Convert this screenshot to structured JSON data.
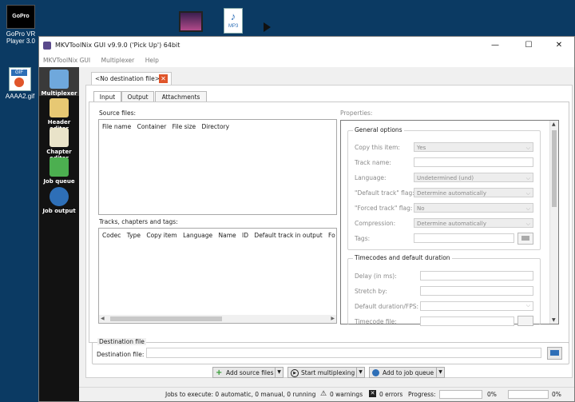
{
  "desktop": {
    "icons": [
      {
        "label": "GoPro VR Player 3.0"
      },
      {
        "label": "AAAA2.gif"
      },
      {
        "label": "MP3"
      }
    ]
  },
  "window": {
    "title": "MKVToolNix GUI v9.9.0 ('Pick Up') 64bit",
    "controls": {
      "minimize": "—",
      "maximize": "☐",
      "close": "✕"
    }
  },
  "menu": [
    "MKVToolNix GUI",
    "Multiplexer",
    "Help"
  ],
  "sidebar": [
    {
      "label": "Multiplexer",
      "icon": "multiplexer-icon"
    },
    {
      "label": "Header editor",
      "icon": "header-editor-icon"
    },
    {
      "label": "Chapter editor",
      "icon": "chapter-editor-icon"
    },
    {
      "label": "Job queue",
      "icon": "job-queue-icon"
    },
    {
      "label": "Job output",
      "icon": "job-output-icon"
    }
  ],
  "doc_tab": {
    "label": "<No destination file>",
    "close": "✕"
  },
  "tabs": [
    "Input",
    "Output",
    "Attachments"
  ],
  "source_files": {
    "label": "Source files:",
    "columns": [
      "File name",
      "Container",
      "File size",
      "Directory"
    ]
  },
  "tracks": {
    "label": "Tracks, chapters and tags:",
    "columns": [
      "Codec",
      "Type",
      "Copy item",
      "Language",
      "Name",
      "ID",
      "Default track in output",
      "Fo"
    ]
  },
  "properties": {
    "label": "Properties:",
    "general": {
      "title": "General options",
      "rows": [
        {
          "key": "Copy this item:",
          "value": "Yes",
          "kind": "combo"
        },
        {
          "key": "Track name:",
          "value": "",
          "kind": "field"
        },
        {
          "key": "Language:",
          "value": "Undetermined (und)",
          "kind": "combo"
        },
        {
          "key": "\"Default track\" flag:",
          "value": "Determine automatically",
          "kind": "combo"
        },
        {
          "key": "\"Forced track\" flag:",
          "value": "No",
          "kind": "combo"
        },
        {
          "key": "Compression:",
          "value": "Determine automatically",
          "kind": "combo"
        },
        {
          "key": "Tags:",
          "value": "",
          "kind": "field"
        }
      ]
    },
    "timecodes": {
      "title": "Timecodes and default duration",
      "rows": [
        {
          "key": "Delay (in ms):",
          "value": ""
        },
        {
          "key": "Stretch by:",
          "value": ""
        },
        {
          "key": "Default duration/FPS:",
          "value": ""
        },
        {
          "key": "Timecode file:",
          "value": ""
        }
      ]
    }
  },
  "destination": {
    "group_title": "Destination file",
    "label": "Destination file:",
    "value": ""
  },
  "actions": {
    "add_source": "Add source files",
    "start": "Start multiplexing",
    "add_queue": "Add to job queue"
  },
  "status": {
    "jobs": "Jobs to execute:  0 automatic, 0 manual, 0 running",
    "warnings": "0 warnings",
    "errors": "0 errors",
    "progress_label": "Progress:",
    "progress1": "0%",
    "progress2": "0%"
  },
  "colors": {
    "accent": "#2e6fb7",
    "sidebar": "#121212",
    "close_tab": "#e0552a"
  }
}
